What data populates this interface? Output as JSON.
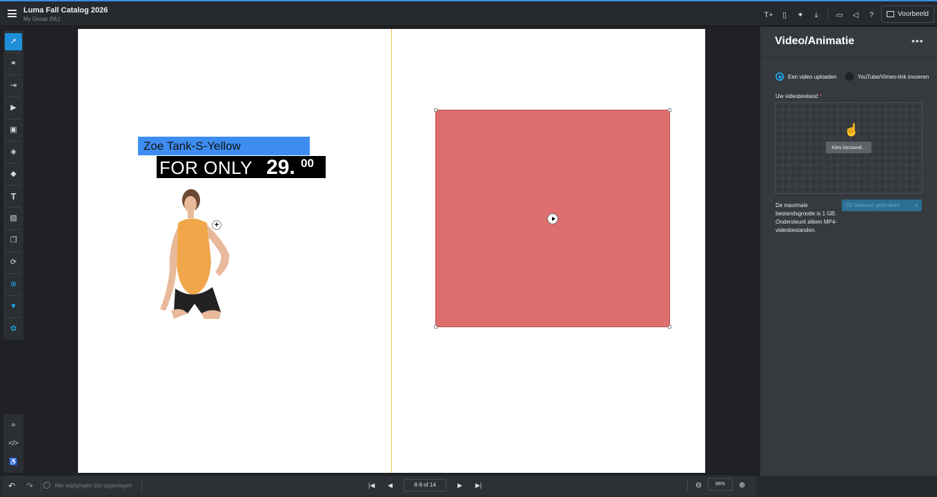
{
  "header": {
    "title": "Luma Fall Catalog 2026",
    "subtitle": "My Group (NL)",
    "preview_label": "Voorbeeld",
    "icons": [
      "add-text-icon",
      "add-page-icon",
      "magic-wand-icon",
      "download-icon",
      "keyboard-icon",
      "announcement-icon",
      "help-icon",
      "preview-monitor-icon"
    ]
  },
  "left_toolbar": {
    "tools": [
      "select-tool",
      "link-tool",
      "export-tool",
      "video-tool",
      "embed-tool",
      "tag-tool",
      "fill-tool",
      "text-tool",
      "image-tool",
      "layers-tool",
      "refresh-tool",
      "add-tool",
      "comment-tool",
      "integrations-tool"
    ],
    "bottom_tools": [
      "crop-tool",
      "code-tool",
      "accessibility-tool"
    ]
  },
  "canvas": {
    "product_name": "Zoe Tank-S-Yellow",
    "price_prefix": "FOR ONLY",
    "price_amount": "29.",
    "price_cents": "00",
    "hotspot_symbol": "+"
  },
  "bottom_bar": {
    "save_status": "Alle wijzigingen zijn opgeslagen",
    "page_indicator": "8-9 of 14",
    "zoom_level": "86%"
  },
  "panel": {
    "title": "Video/Animatie",
    "more": "•••",
    "radio_upload": "Een video uploaden",
    "radio_link": "YouTube/Vimeo-link invoeren",
    "file_label": "Uw videobestand",
    "required_mark": "*",
    "choose_file": "Kies bestand...",
    "help_text": "De maximale bestandsgrootte is 1 GB. Ondersteunt alleen MP4-videobestanden.",
    "use_file": "Dit bestand gebruiken"
  }
}
